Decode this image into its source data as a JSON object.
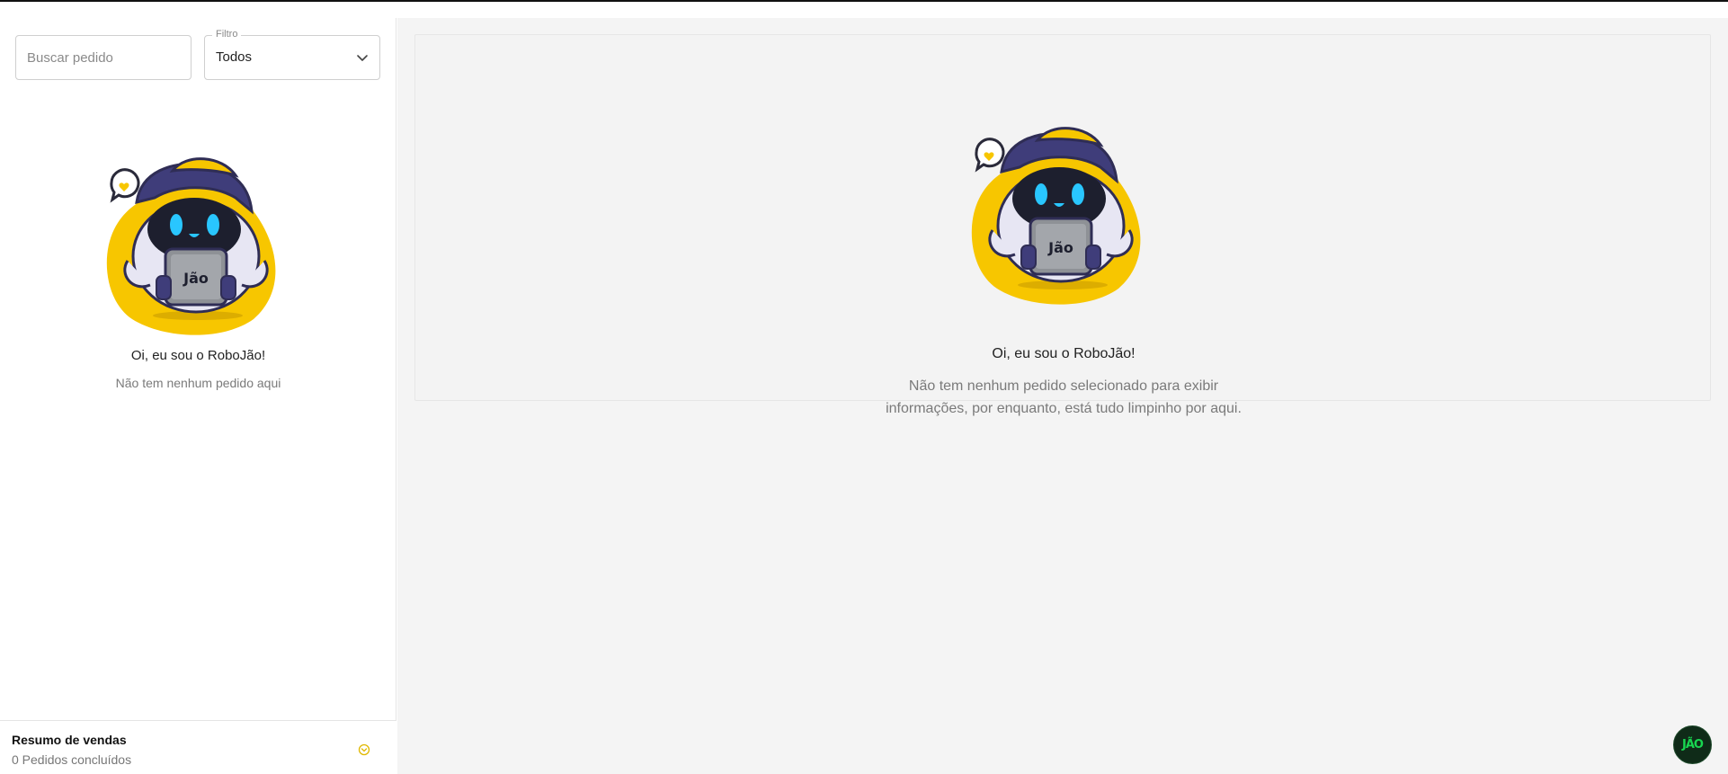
{
  "sidebar": {
    "search": {
      "placeholder": "Buscar pedido",
      "value": ""
    },
    "filter": {
      "legend": "Filtro",
      "selected": "Todos"
    },
    "empty": {
      "title": "Oi, eu sou o RoboJão!",
      "subtitle": "Não tem nenhum pedido aqui"
    },
    "summary": {
      "title": "Resumo de vendas",
      "subtitle": "0 Pedidos concluídos",
      "icon": "chevron-circle-icon"
    }
  },
  "main": {
    "empty": {
      "title": "Oi, eu sou o RoboJão!",
      "subtitle": "Não tem nenhum pedido selecionado para exibir informações, por enquanto, está tudo limpinho por aqui."
    }
  },
  "robot": {
    "tablet_text": "Jão",
    "icon": "robojao-mascot-icon"
  },
  "avatar": {
    "text": "JÃO",
    "icon": "jao-logo-icon"
  },
  "colors": {
    "accent": "#f7c600",
    "robot_cap": "#3f3d7a",
    "robot_face": "#1d1f2e",
    "robot_eyes": "#29c6ff",
    "avatar_bg": "#0f2b18",
    "avatar_text": "#18d650"
  }
}
